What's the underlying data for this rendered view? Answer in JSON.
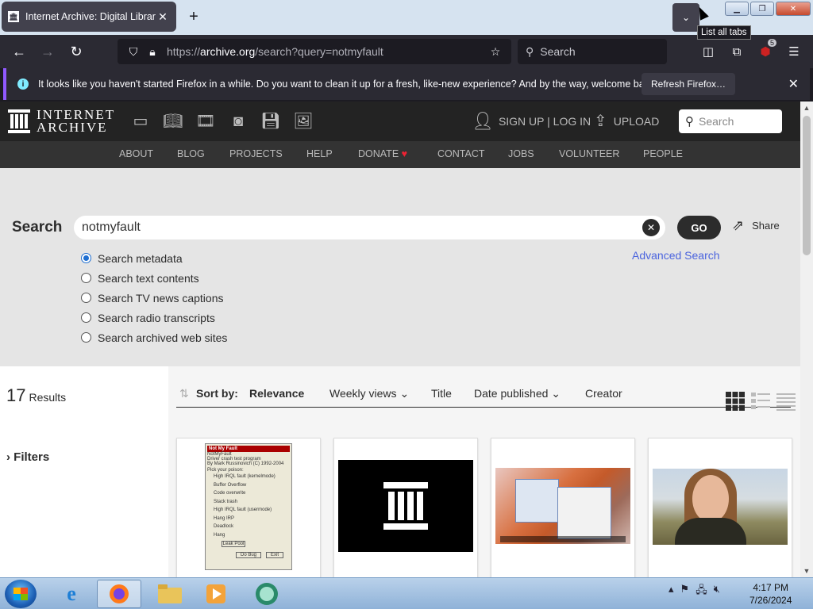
{
  "browser": {
    "tab_title": "Internet Archive: Digital Library",
    "tab_close": "✕",
    "new_tab": "+",
    "list_all_tabs_tooltip": "List all tabs",
    "url_prefix": "https://",
    "url_domain": "archive.org",
    "url_path": "/search?query=notmyfault",
    "search_placeholder": "Search",
    "extension_badge": "5"
  },
  "notification": {
    "message": "It looks like you haven't started Firefox in a while. Do you want to clean it up for a fresh, like-new experience? And by the way, welcome back!",
    "button": "Refresh Firefox…",
    "close": "✕"
  },
  "ia_header": {
    "logo_line1": "INTERNET",
    "logo_line2": "ARCHIVE",
    "signup": "SIGN UP | LOG IN",
    "upload": "UPLOAD",
    "search_placeholder": "Search"
  },
  "ia_menu": [
    "ABOUT",
    "BLOG",
    "PROJECTS",
    "HELP",
    "DONATE",
    "CONTACT",
    "JOBS",
    "VOLUNTEER",
    "PEOPLE"
  ],
  "search": {
    "label": "Search",
    "query": "notmyfault",
    "go": "GO",
    "share": "Share",
    "advanced": "Advanced Search",
    "options": [
      {
        "label": "Search metadata",
        "checked": true
      },
      {
        "label": "Search text contents",
        "checked": false
      },
      {
        "label": "Search TV news captions",
        "checked": false
      },
      {
        "label": "Search radio transcripts",
        "checked": false
      },
      {
        "label": "Search archived web sites",
        "checked": false
      }
    ]
  },
  "results": {
    "count": "17",
    "count_label": "Results",
    "filters": "Filters",
    "sort_label": "Sort by:",
    "sort_options": [
      "Relevance",
      "Weekly views",
      "Title",
      "Date published",
      "Creator"
    ]
  },
  "thumb1": {
    "title": "Not My Fault",
    "lines": [
      "NotMyFault",
      "Driver crash test program",
      "By Mark Russinovich (C) 1992-2004",
      "Pick your poison:"
    ],
    "options": [
      "High IRQL fault (kernelmode)",
      "Buffer Overflow",
      "Code overwrite",
      "Stack trash",
      "High IRQL fault (usermode)",
      "Hang IRP",
      "Deadlock",
      "Hang"
    ],
    "leak_button": "Leak Pool",
    "do_bug": "Do Bug",
    "exit": "Exit"
  },
  "taskbar": {
    "time": "4:17 PM",
    "date": "7/26/2024"
  },
  "colors": {
    "ia_dark": "#232323",
    "ia_menu": "#333333",
    "link_blue": "#4b64de",
    "firefox_purple": "#9059ff"
  }
}
